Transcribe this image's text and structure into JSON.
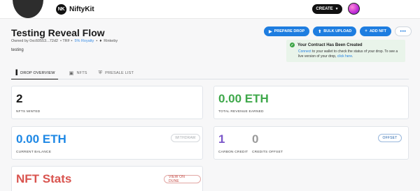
{
  "nav": {
    "logo_mark": "NK",
    "logo_text": "NiftyKit",
    "create_label": "CREATE"
  },
  "header": {
    "title": "Testing Reveal Flow",
    "owned_by": "Owned by 0xc60553...72d2",
    "symbol": "• TRF •",
    "royalty": "5% Royalty",
    "network_sep": "•",
    "network": "Rinkeby",
    "description": "testing"
  },
  "actions": {
    "prepare_drop": "PREPARE DROP",
    "bulk_upload": "BULK UPLOAD",
    "add_nft": "ADD NFT",
    "more": "•••"
  },
  "notice": {
    "title": "Your Contract Has Been Created",
    "body_link1": "Connect",
    "body_text1": " to your wallet to check the status of your drop. To see a live version of your drop, ",
    "body_link2": "click here",
    "body_text2": "."
  },
  "tabs": [
    {
      "label": "DROP OVERVIEW",
      "active": true
    },
    {
      "label": "NFTS",
      "active": false
    },
    {
      "label": "PRESALE LIST",
      "active": false
    }
  ],
  "cards": {
    "nfts_minted": {
      "value": "2",
      "caption": "NFTS MINTED"
    },
    "revenue": {
      "value": "0.00 ETH",
      "caption": "TOTAL REVENUE EARNED"
    },
    "balance": {
      "value": "0.00 ETH",
      "caption": "CURRENT BALANCE",
      "button": "WITHDRAW"
    },
    "carbon": {
      "value": "1",
      "caption": "CARBON CREDIT",
      "offset_value": "0",
      "offset_caption": "CREDITS OFFSET",
      "button": "OFFSET"
    },
    "stats": {
      "title": "NFT Stats",
      "button": "VIEW ON DUNE"
    }
  },
  "colors": {
    "accent_blue": "#1e7de0",
    "revenue_green": "#3ea84a",
    "balance_blue": "#1e88e5",
    "carbon_purple": "#7b57c9",
    "offset_grey": "#9a9a9a",
    "stats_red": "#d9544f"
  }
}
